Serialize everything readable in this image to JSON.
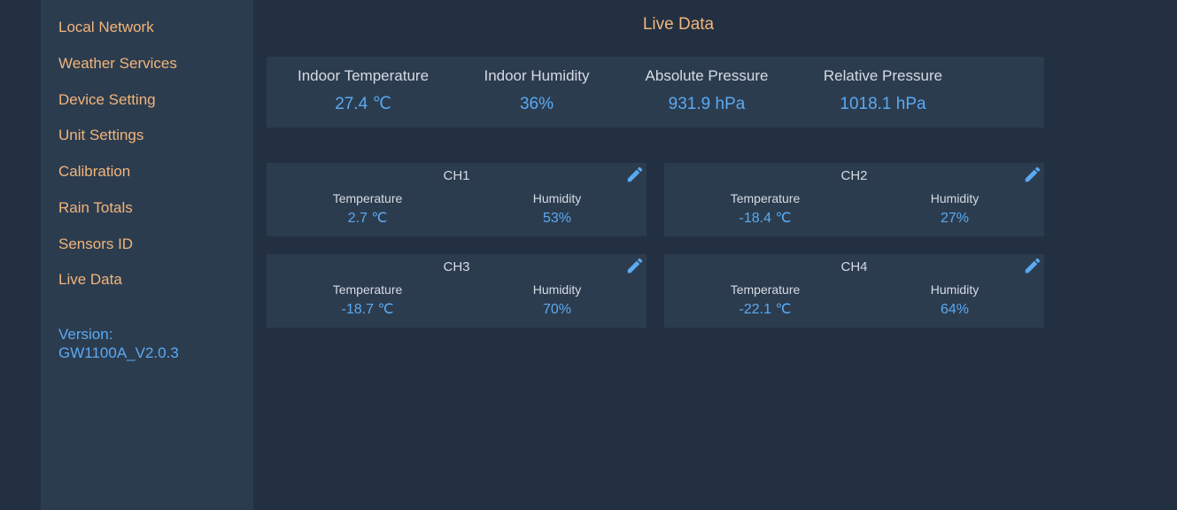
{
  "sidebar": {
    "items": [
      {
        "label": "Local Network"
      },
      {
        "label": "Weather Services"
      },
      {
        "label": "Device Setting"
      },
      {
        "label": "Unit Settings"
      },
      {
        "label": "Calibration"
      },
      {
        "label": "Rain Totals"
      },
      {
        "label": "Sensors ID"
      },
      {
        "label": "Live Data"
      }
    ],
    "version_label": "Version:",
    "version_value": "GW1100A_V2.0.3"
  },
  "main": {
    "title": "Live Data",
    "summary": [
      {
        "label": "Indoor Temperature",
        "value": "27.4 ℃"
      },
      {
        "label": "Indoor Humidity",
        "value": "36%"
      },
      {
        "label": "Absolute Pressure",
        "value": "931.9 hPa"
      },
      {
        "label": "Relative Pressure",
        "value": "1018.1 hPa"
      }
    ],
    "channels": [
      {
        "name": "CH1",
        "temp_label": "Temperature",
        "temp": "2.7 ℃",
        "hum_label": "Humidity",
        "hum": "53%"
      },
      {
        "name": "CH2",
        "temp_label": "Temperature",
        "temp": "-18.4 ℃",
        "hum_label": "Humidity",
        "hum": "27%"
      },
      {
        "name": "CH3",
        "temp_label": "Temperature",
        "temp": "-18.7 ℃",
        "hum_label": "Humidity",
        "hum": "70%"
      },
      {
        "name": "CH4",
        "temp_label": "Temperature",
        "temp": "-22.1 ℃",
        "hum_label": "Humidity",
        "hum": "64%"
      }
    ]
  },
  "colors": {
    "background": "#223041",
    "panel": "#2c3c4f",
    "nav_text": "#f1b57a",
    "value_text": "#5aaaf2",
    "label_text": "#d5dbe3"
  },
  "icons": {
    "edit": "pencil-icon"
  }
}
